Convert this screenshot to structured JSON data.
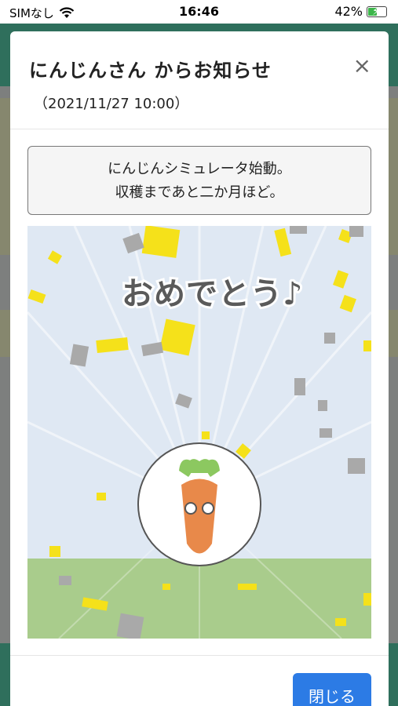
{
  "status_bar": {
    "carrier": "SIMなし",
    "time": "16:46",
    "battery_percent": "42%"
  },
  "modal": {
    "title": "にんじんさん からお知らせ",
    "date": "（2021/11/27 10:00）",
    "close_icon": "×",
    "message_line1": "にんじんシミュレータ始動。",
    "message_line2": "収穫まであと二か月ほど。",
    "celebration_text": "おめでとう♪",
    "close_button_label": "閉じる"
  },
  "colors": {
    "sky": "#dfe8f3",
    "ground": "#a9cc8c",
    "confetti_yellow": "#f5e11a",
    "confetti_gray": "#a9a9a9",
    "carrot": "#e8894a",
    "leaves": "#8cc860",
    "button": "#2c7be5"
  }
}
